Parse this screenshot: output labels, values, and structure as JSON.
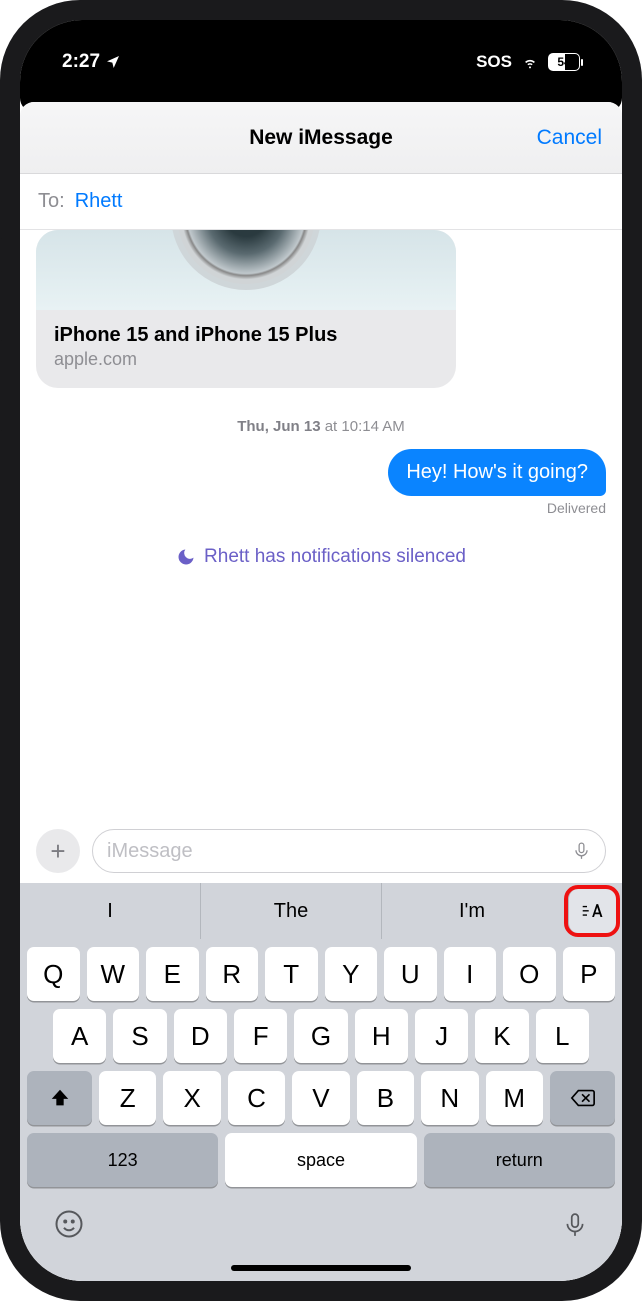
{
  "status": {
    "time": "2:27",
    "sos": "SOS",
    "battery": "54"
  },
  "header": {
    "title": "New iMessage",
    "cancel": "Cancel"
  },
  "to": {
    "label": "To:",
    "name": "Rhett"
  },
  "link": {
    "title": "iPhone 15 and iPhone 15 Plus",
    "domain": "apple.com"
  },
  "timestamp": {
    "day": "Thu, Jun 13",
    "at": " at ",
    "time": "10:14 AM"
  },
  "message": {
    "text": "Hey! How's it going?",
    "status": "Delivered"
  },
  "silenced": "Rhett has notifications silenced",
  "input": {
    "placeholder": "iMessage"
  },
  "suggestions": [
    "I",
    "The",
    "I'm"
  ],
  "keyboard": {
    "row1": [
      "Q",
      "W",
      "E",
      "R",
      "T",
      "Y",
      "U",
      "I",
      "O",
      "P"
    ],
    "row2": [
      "A",
      "S",
      "D",
      "F",
      "G",
      "H",
      "J",
      "K",
      "L"
    ],
    "row3": [
      "Z",
      "X",
      "C",
      "V",
      "B",
      "N",
      "M"
    ],
    "numbers": "123",
    "space": "space",
    "return": "return"
  }
}
